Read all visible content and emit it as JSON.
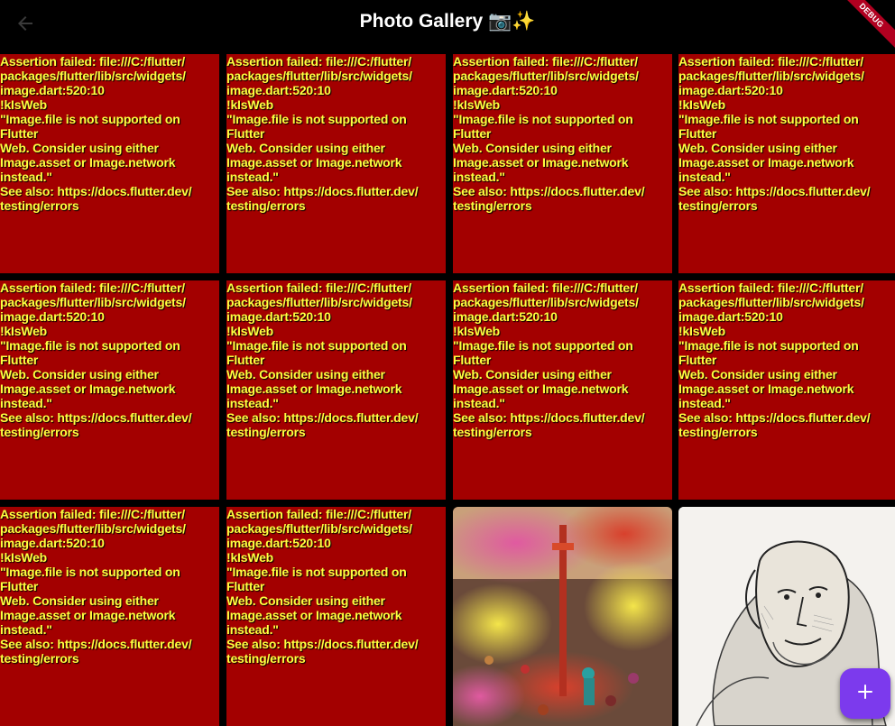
{
  "appbar": {
    "title": "Photo Gallery 📷✨",
    "back_icon": "arrow-back-icon",
    "debug_banner": "DEBUG"
  },
  "error_message": "Assertion failed: file:///C:/flutter/\npackages/flutter/lib/src/widgets/\nimage.dart:520:10\n!kIsWeb\n\"Image.file is not supported on Flutter\nWeb. Consider using either\nImage.asset or Image.network\ninstead.\"\nSee also: https://docs.flutter.dev/\ntesting/errors",
  "tiles": [
    {
      "kind": "error"
    },
    {
      "kind": "error"
    },
    {
      "kind": "error"
    },
    {
      "kind": "error"
    },
    {
      "kind": "error"
    },
    {
      "kind": "error"
    },
    {
      "kind": "error"
    },
    {
      "kind": "error"
    },
    {
      "kind": "error"
    },
    {
      "kind": "error"
    },
    {
      "kind": "photo",
      "subject": "holi-festival-crowd-photo"
    },
    {
      "kind": "photo",
      "subject": "engraved-portrait-photo"
    }
  ],
  "fab": {
    "icon": "plus-icon"
  },
  "colors": {
    "background": "#000000",
    "error_tile": "#a30000",
    "error_text": "#ffff40",
    "fab": "#7c3aed",
    "debug_banner": "#b00020"
  }
}
